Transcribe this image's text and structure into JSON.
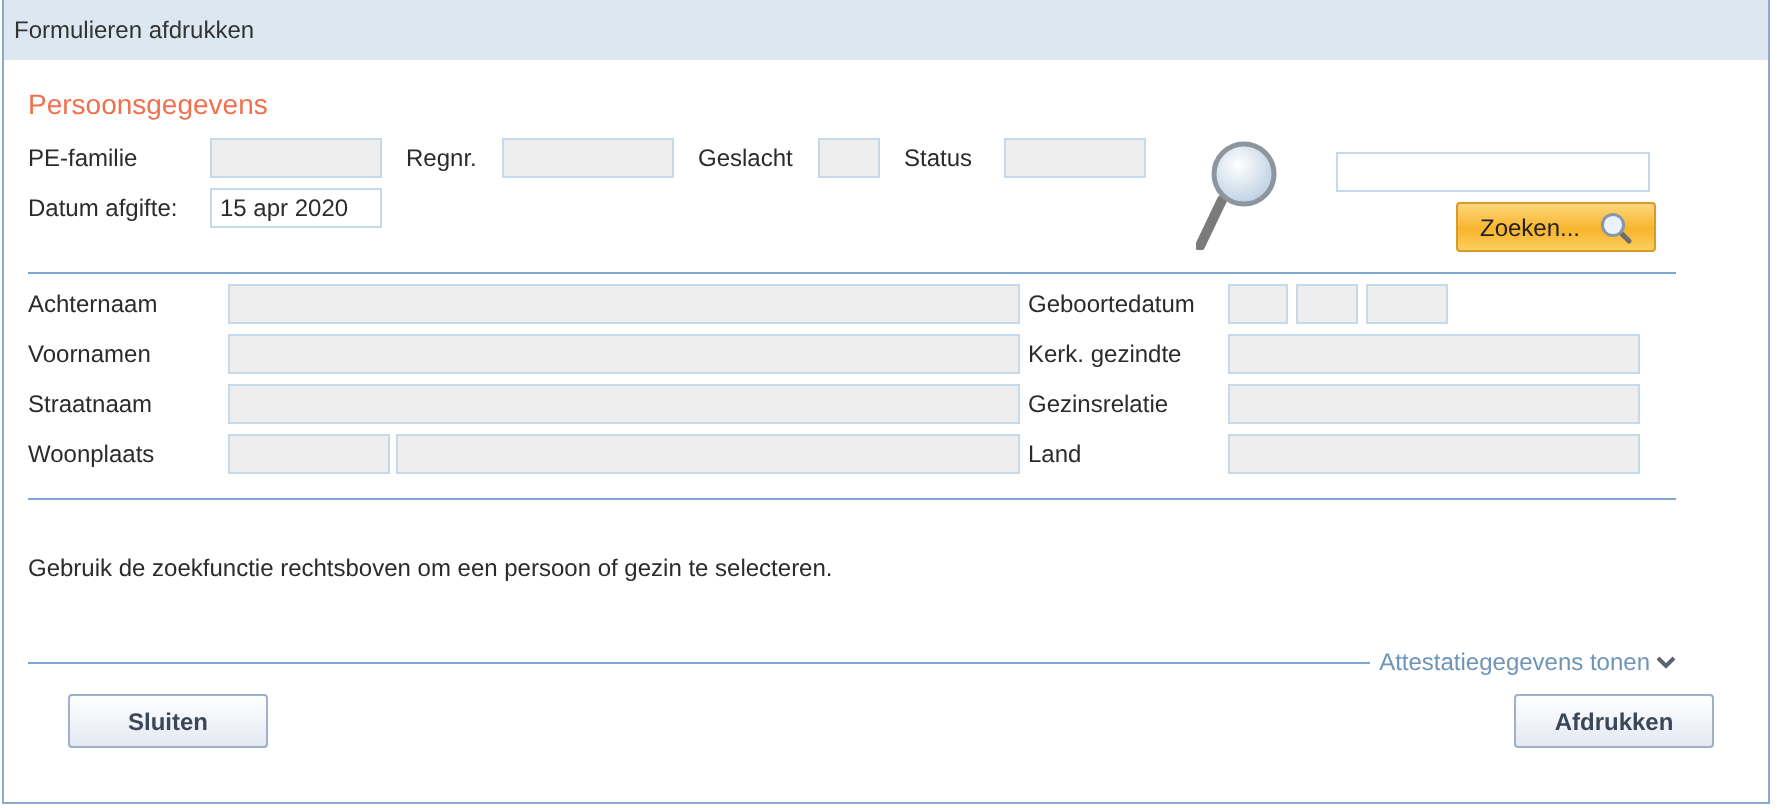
{
  "window": {
    "title": "Formulieren afdrukken"
  },
  "section_title": "Persoonsgegevens",
  "header_rows": [
    [
      {
        "label": "PE-familie",
        "readonly": true
      },
      {
        "label": "Regnr.",
        "readonly": true
      },
      {
        "label": "Geslacht",
        "readonly": true
      },
      {
        "label": "Status",
        "readonly": true
      }
    ],
    [
      {
        "label": "Datum afgifte:",
        "value": "15 apr 2020",
        "readonly": false
      }
    ]
  ],
  "search": {
    "readonly": false,
    "button": "Zoeken..."
  },
  "person_rows": [
    {
      "left": {
        "label": "Achternaam",
        "boxes": [
          {
            "readonly": true
          }
        ]
      },
      "right": {
        "label": "Geboortedatum",
        "boxes": [
          {
            "readonly": true
          },
          {
            "readonly": true
          },
          {
            "readonly": true
          }
        ]
      }
    },
    {
      "left": {
        "label": "Voornamen",
        "boxes": [
          {
            "readonly": true
          }
        ]
      },
      "right": {
        "label": "Kerk. gezindte",
        "boxes": [
          {
            "readonly": true
          }
        ]
      }
    },
    {
      "left": {
        "label": "Straatnaam",
        "boxes": [
          {
            "readonly": true
          }
        ]
      },
      "right": {
        "label": "Gezinsrelatie",
        "boxes": [
          {
            "readonly": true
          }
        ]
      }
    },
    {
      "left": {
        "label": "Woonplaats",
        "boxes": [
          {
            "readonly": true
          },
          {
            "readonly": true
          }
        ]
      },
      "right": {
        "label": "Land",
        "boxes": [
          {
            "readonly": true
          }
        ]
      }
    }
  ],
  "hint": "Gebruik de zoekfunctie rechtsboven om een persoon of gezin te selecteren.",
  "expander": {
    "label": "Attestatiegegevens tonen",
    "expanded": false
  },
  "buttons": [
    {
      "label": "Sluiten"
    },
    {
      "label": "Afdrukken"
    }
  ]
}
